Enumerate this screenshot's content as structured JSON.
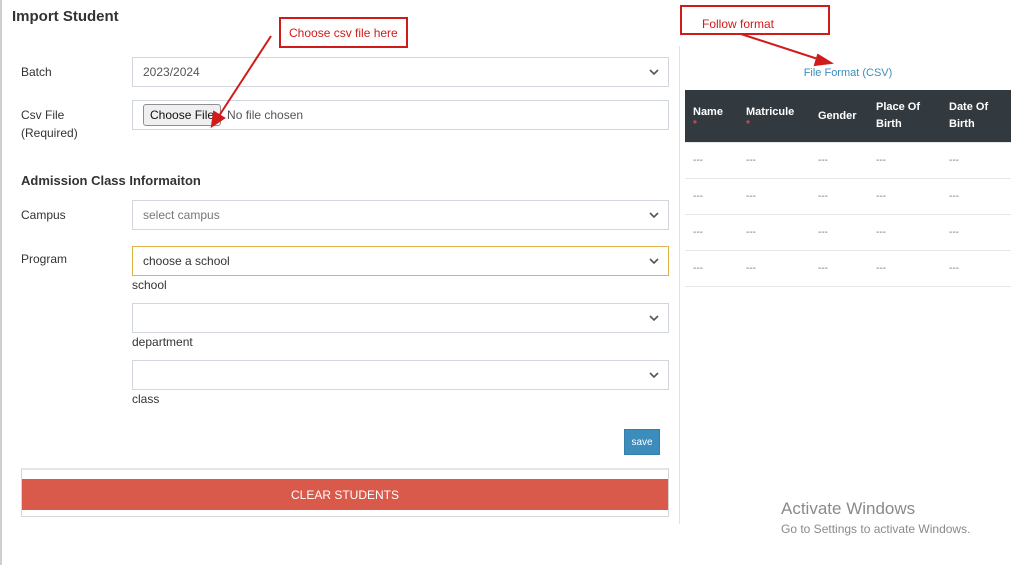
{
  "page": {
    "title": "Import Student"
  },
  "form": {
    "batch": {
      "label": "Batch",
      "value": "2023/2024"
    },
    "csv_file": {
      "label_line1": "Csv File",
      "label_line2": "(Required)",
      "button_label": "Choose File",
      "status": "No file chosen"
    },
    "section_title": "Admission Class Informaiton",
    "campus": {
      "label": "Campus",
      "value": "select campus"
    },
    "program": {
      "label": "Program",
      "school": {
        "value": "choose a school",
        "caption": "school"
      },
      "department": {
        "value": "",
        "caption": "department"
      },
      "class": {
        "value": "",
        "caption": "class"
      }
    },
    "save_label": "save",
    "clear_label": "CLEAR STUDENTS"
  },
  "format": {
    "link_label": "File Format (CSV)",
    "columns": [
      {
        "name": "Name",
        "required": true,
        "marker": "*"
      },
      {
        "name": "Matricule",
        "required": true,
        "marker": "*"
      },
      {
        "name": "Gender",
        "required": false
      },
      {
        "name": "Place Of Birth",
        "required": false
      },
      {
        "name": "Date Of Birth",
        "required": false
      }
    ],
    "rows": [
      [
        "---",
        "---",
        "---",
        "---",
        "---"
      ],
      [
        "---",
        "---",
        "---",
        "---",
        "---"
      ],
      [
        "---",
        "---",
        "---",
        "---",
        "---"
      ],
      [
        "---",
        "---",
        "---",
        "---",
        "---"
      ]
    ]
  },
  "annotations": {
    "csv_note": "Choose csv file here",
    "format_note": "Follow format"
  },
  "watermark": {
    "title": "Activate Windows",
    "subtitle": "Go to Settings to activate Windows."
  },
  "colors": {
    "clear_button": "#d9594a",
    "save_button": "#3c8dbc",
    "table_header": "#333a3f",
    "annotation": "#d11b1b",
    "link": "#3c8dbc"
  }
}
